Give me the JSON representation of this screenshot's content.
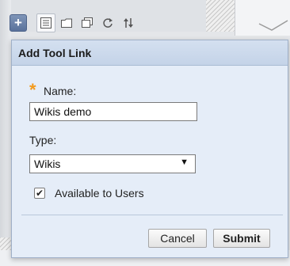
{
  "toolbar": {
    "add_symbol": "+",
    "tools": [
      "list-view-icon",
      "folder-icon",
      "windows-icon",
      "refresh-icon",
      "sort-icon"
    ]
  },
  "dialog": {
    "title": "Add Tool Link",
    "name_label": "Name:",
    "name_value": "Wikis demo",
    "type_label": "Type:",
    "type_selected": "Wikis",
    "available_label": "Available to Users",
    "available_checked": true,
    "cancel_label": "Cancel",
    "submit_label": "Submit"
  },
  "colors": {
    "dialog_bg": "#e5edf8",
    "header_bg": "#c4d3e8",
    "required_star": "#f39a1c",
    "add_button": "#5a729b"
  }
}
